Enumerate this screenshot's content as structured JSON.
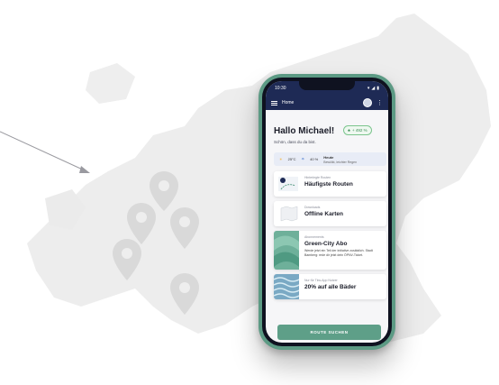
{
  "statusbar": {
    "time": "10:30"
  },
  "appbar": {
    "title": "Home"
  },
  "greeting": "Hallo Michael!",
  "badge": "+ 492 %",
  "subtitle": "Schön, dass du da bist.",
  "weather": {
    "temp": "25°C",
    "rain": "40 %",
    "day": "Heute",
    "desc": "Bewölkt, leichter Regen"
  },
  "cards": [
    {
      "small": "Hinterlegte Routen",
      "big": "Häufigste Routen"
    },
    {
      "small": "Downloads",
      "big": "Offline Karten"
    },
    {
      "small": "Abonnements",
      "big": "Green-City Abo",
      "desc": "Werde jetzt ein Teil der Initiative zusätzlich. Stadt Bamberg: rede dir jetzt dein ÖPNV-Ticket."
    },
    {
      "small": "Nur für Tkw-App Nutzer",
      "big": "20% auf alle Bäder"
    }
  ],
  "button": "ROUTE SUCHEN",
  "colors": {
    "phone": "#5c9a84",
    "appbar": "#1e2a55",
    "button": "#5e9f88",
    "map": "#ededed"
  }
}
